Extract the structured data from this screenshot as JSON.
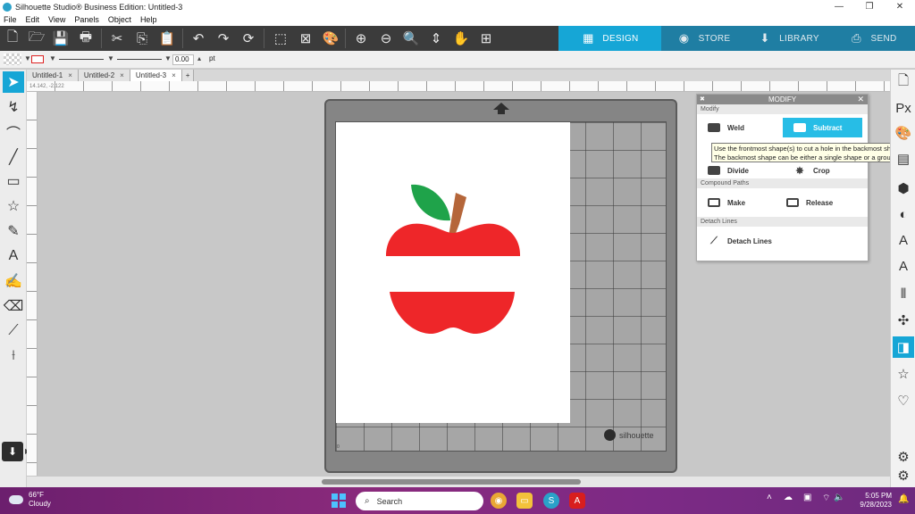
{
  "window": {
    "title": "Silhouette Studio® Business Edition: Untitled-3",
    "controls": {
      "minimize": "—",
      "maximize": "❐",
      "close": "✕"
    }
  },
  "menu": [
    "File",
    "Edit",
    "View",
    "Panels",
    "Object",
    "Help"
  ],
  "modes": [
    {
      "label": "DESIGN",
      "icon": "grid-icon",
      "active": true
    },
    {
      "label": "STORE",
      "icon": "store-icon",
      "active": false
    },
    {
      "label": "LIBRARY",
      "icon": "library-icon",
      "active": false
    },
    {
      "label": "SEND",
      "icon": "send-icon",
      "active": false
    }
  ],
  "line_toolbar": {
    "line_width": "0.00",
    "unit": "pt"
  },
  "tabs": [
    {
      "label": "Untitled-1",
      "close": "×"
    },
    {
      "label": "Untitled-2",
      "close": "×"
    },
    {
      "label": "Untitled-3",
      "close": "×",
      "active": true
    },
    {
      "label": "+"
    }
  ],
  "ruler_readout": "14.142, -2.122",
  "mat": {
    "brand": "silhouette",
    "origin": "0"
  },
  "modify_panel": {
    "title": "MODIFY",
    "sections": {
      "modify": "Modify",
      "compound": "Compound Paths",
      "detach": "Detach Lines"
    },
    "buttons": {
      "weld": "Weld",
      "subtract": "Subtract",
      "divide": "Divide",
      "crop": "Crop",
      "make": "Make",
      "release": "Release",
      "detach": "Detach Lines"
    },
    "tooltip_line1": "Use the frontmost shape(s) to cut a hole in the backmost shape.",
    "tooltip_line2": "The backmost shape can be either a single shape or a group"
  },
  "colors": {
    "accent": "#16a6d6",
    "apple_red": "#ee2629",
    "leaf_green": "#1fa34a",
    "stem_brown": "#b5663a"
  },
  "taskbar": {
    "temperature": "66°F",
    "condition": "Cloudy",
    "search_placeholder": "Search",
    "time": "5:05 PM",
    "date": "9/28/2023"
  }
}
